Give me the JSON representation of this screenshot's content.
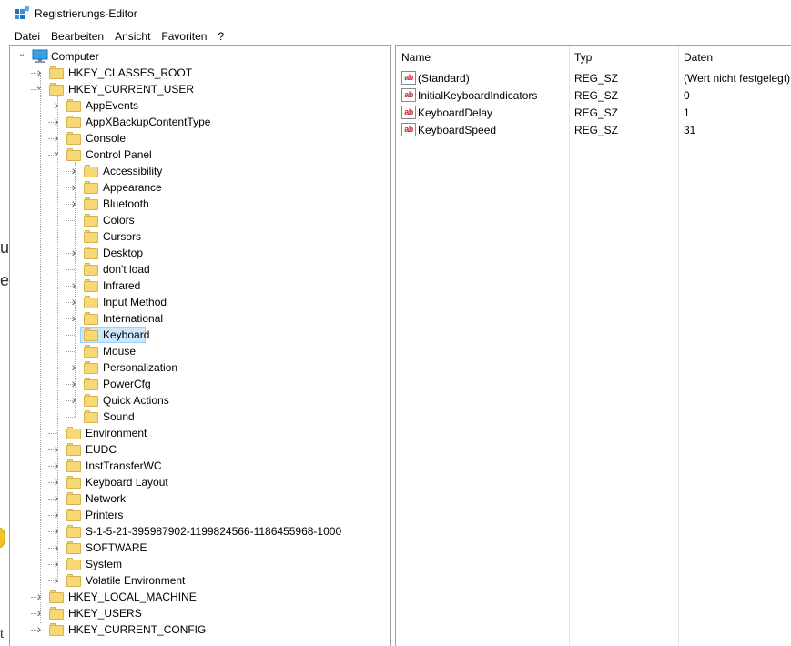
{
  "window": {
    "title": "Registrierungs-Editor"
  },
  "menu": [
    "Datei",
    "Bearbeiten",
    "Ansicht",
    "Favoriten",
    "?"
  ],
  "tree": {
    "root": "Computer",
    "hives": {
      "classes_root": "HKEY_CLASSES_ROOT",
      "current_user": "HKEY_CURRENT_USER",
      "local_machine": "HKEY_LOCAL_MACHINE",
      "users": "HKEY_USERS",
      "current_config": "HKEY_CURRENT_CONFIG"
    },
    "current_user_children": [
      "AppEvents",
      "AppXBackupContentType",
      "Console",
      "Control Panel",
      "Environment",
      "EUDC",
      "InstTransferWC",
      "Keyboard Layout",
      "Network",
      "Printers",
      "S-1-5-21-395987902-1199824566-1186455968-1000",
      "SOFTWARE",
      "System",
      "Volatile Environment"
    ],
    "control_panel_children": [
      "Accessibility",
      "Appearance",
      "Bluetooth",
      "Colors",
      "Cursors",
      "Desktop",
      "don't load",
      "Infrared",
      "Input Method",
      "International",
      "Keyboard",
      "Mouse",
      "Personalization",
      "PowerCfg",
      "Quick Actions",
      "Sound"
    ],
    "selected": "Keyboard"
  },
  "list": {
    "columns": {
      "name": "Name",
      "type": "Typ",
      "data": "Daten"
    },
    "rows": [
      {
        "name": "(Standard)",
        "type": "REG_SZ",
        "data": "(Wert nicht festgelegt)"
      },
      {
        "name": "InitialKeyboardIndicators",
        "type": "REG_SZ",
        "data": "0"
      },
      {
        "name": "KeyboardDelay",
        "type": "REG_SZ",
        "data": "1"
      },
      {
        "name": "KeyboardSpeed",
        "type": "REG_SZ",
        "data": "31"
      }
    ],
    "icon_text": "ab"
  },
  "background_fragments": [
    "u",
    "e",
    "t"
  ],
  "colors": {
    "folder": "#f8d775",
    "selection": "#cce8ff",
    "string_icon": "#c0262d"
  }
}
